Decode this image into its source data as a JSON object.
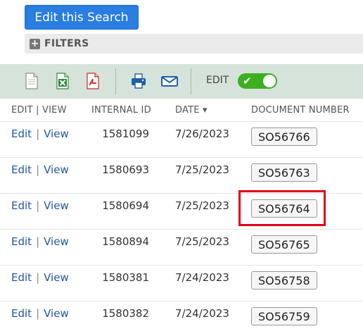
{
  "search": {
    "edit_button_label": "Edit this Search"
  },
  "filters": {
    "label": "FILTERS",
    "expand_symbol": "+"
  },
  "toolbar": {
    "icons": [
      "new-document-icon",
      "export-excel-icon",
      "export-pdf-icon",
      "print-icon",
      "email-icon"
    ],
    "edit_label": "EDIT",
    "edit_toggle_on": true,
    "toggle_check": "✔"
  },
  "table": {
    "columns": [
      "EDIT | VIEW",
      "INTERNAL ID",
      "DATE ▾",
      "DOCUMENT NUMBER"
    ],
    "edit_label": "Edit",
    "view_label": "View",
    "separator": "|",
    "rows": [
      {
        "internal_id": "1581099",
        "date": "7/26/2023",
        "document_number": "SO56766"
      },
      {
        "internal_id": "1580693",
        "date": "7/25/2023",
        "document_number": "SO56763"
      },
      {
        "internal_id": "1580694",
        "date": "7/25/2023",
        "document_number": "SO56764"
      },
      {
        "internal_id": "1580894",
        "date": "7/25/2023",
        "document_number": "SO56765"
      },
      {
        "internal_id": "1580381",
        "date": "7/24/2023",
        "document_number": "SO56758"
      },
      {
        "internal_id": "1580382",
        "date": "7/24/2023",
        "document_number": "SO56759"
      }
    ],
    "highlighted_row_index": 2
  },
  "colors": {
    "primary_button": "#2a7de1",
    "toolbar_bg": "#d6e3da",
    "toggle_on": "#3cb020",
    "link": "#2257a6",
    "highlight": "#e2001a"
  }
}
